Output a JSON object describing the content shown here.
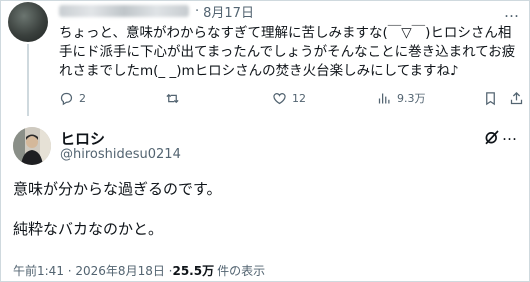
{
  "reply": {
    "dot": "·",
    "date": "8月17日",
    "more": "…",
    "text": "ちょっと、意味がわからなすぎて理解に苦しみますな(￣▽￣)ヒロシさん相手にド派手に下心が出てまったんでしょうがそんなことに巻き込まれてお疲れさまでしたm(_ _)mヒロシさんの焚き火台楽しみにしてますね♪",
    "actions": {
      "replies": "2",
      "retweets": "",
      "likes": "12",
      "views": "9.3万"
    }
  },
  "main": {
    "name": "ヒロシ",
    "handle": "@hiroshidesu0214",
    "more": "…",
    "text": "意味が分からな過ぎるのです。\n\n純粋なバカなのかと。",
    "time": "午前1:41 · 2026年8月18日 · ",
    "view_count": "25.5万",
    "view_label": "件の表示"
  },
  "colors": {
    "text": "#0f1419",
    "secondary": "#536471",
    "border": "#cfd9de"
  },
  "icons": [
    "reply-icon",
    "retweet-icon",
    "like-icon",
    "views-icon",
    "share-icon",
    "grok-icon",
    "more-icon"
  ]
}
